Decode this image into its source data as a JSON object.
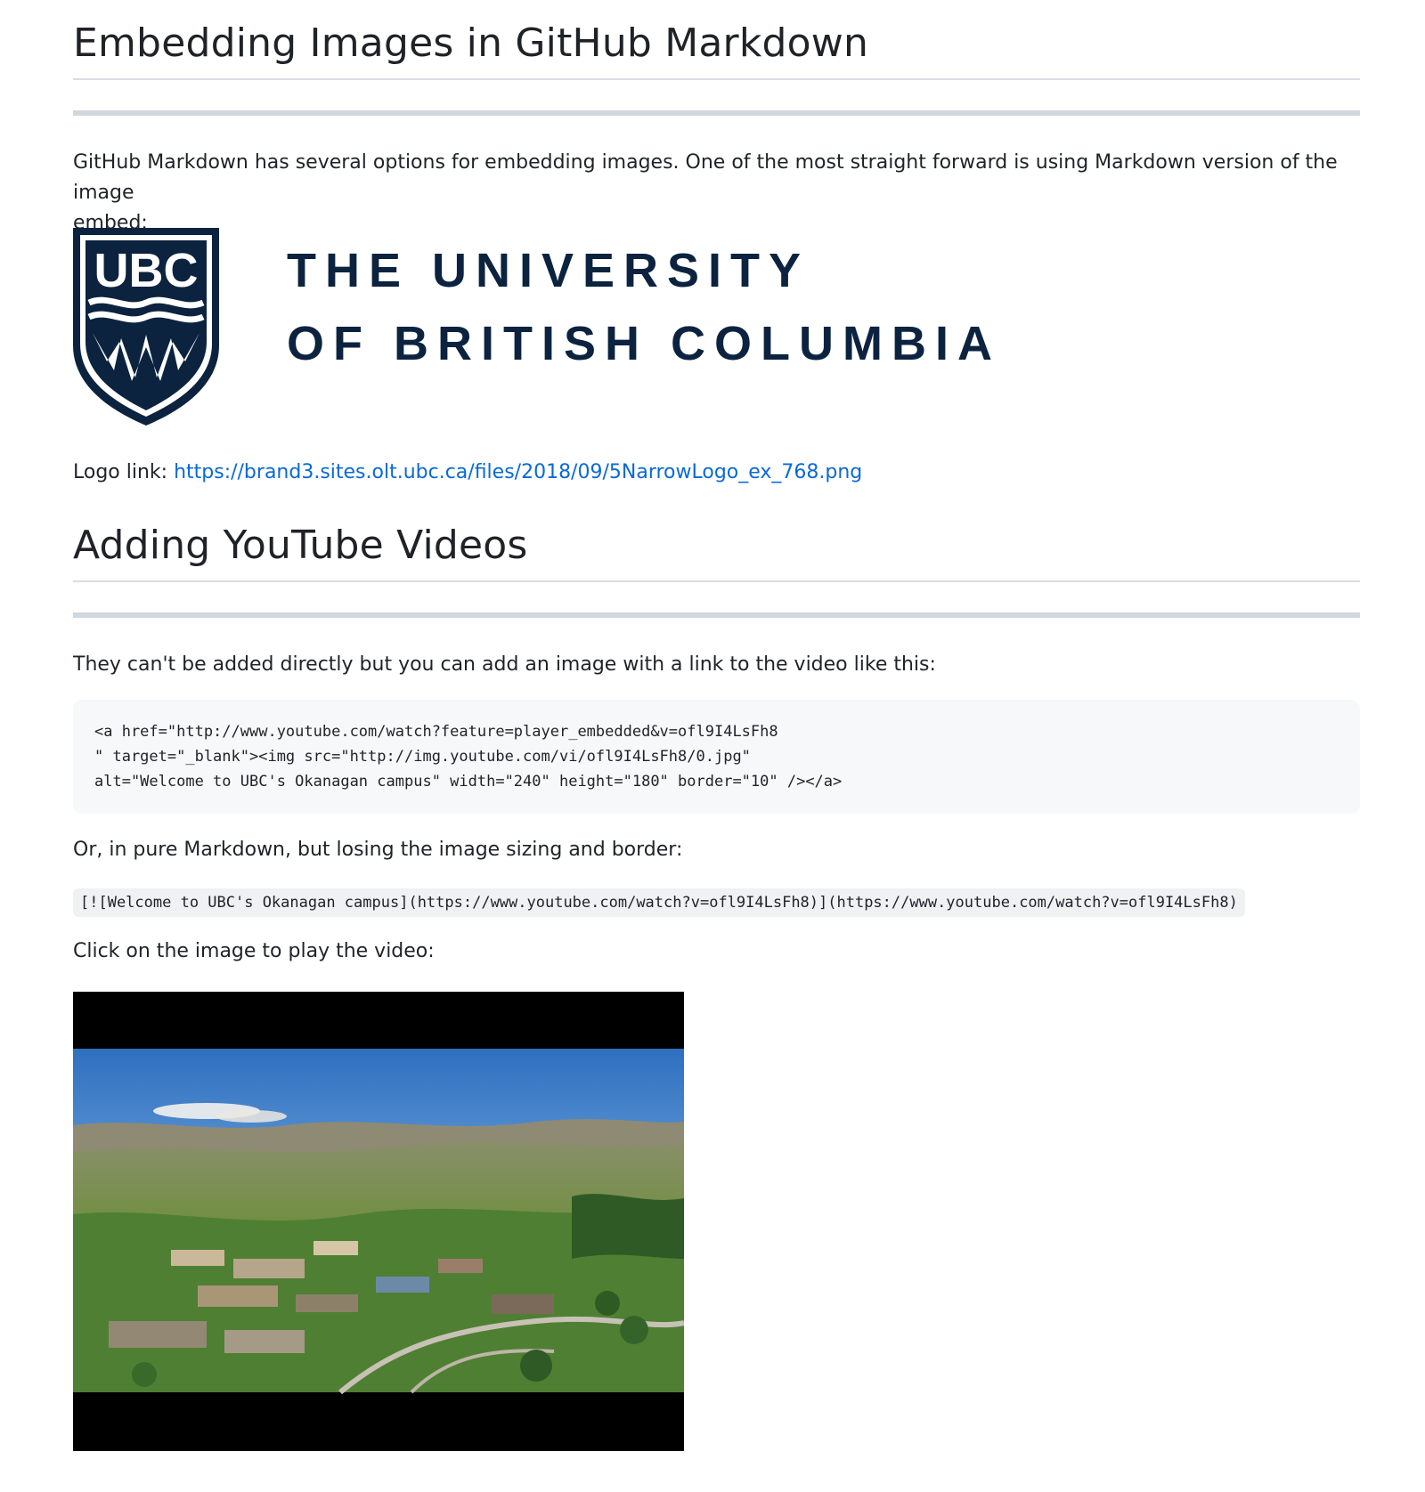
{
  "section1": {
    "heading": "Embedding Images in GitHub Markdown",
    "intro_line1": "GitHub Markdown has several options for embedding images. One of the most straight forward is using Markdown version of the image",
    "intro_line2": "embed:",
    "logo": {
      "shield_text": "UBC",
      "wordmark_line1": "THE UNIVERSITY",
      "wordmark_line2": "OF BRITISH COLUMBIA",
      "color": "#0c2340"
    },
    "logo_link_label": "Logo link:",
    "logo_link_url": "https://brand3.sites.olt.ubc.ca/files/2018/09/5NarrowLogo_ex_768.png"
  },
  "section2": {
    "heading": "Adding YouTube Videos",
    "intro": "They can't be added directly but you can add an image with a link to the video like this:",
    "code_lines": [
      "<a href=\"http://www.youtube.com/watch?feature=player_embedded&v=ofl9I4LsFh8",
      "\" target=\"_blank\"><img src=\"http://img.youtube.com/vi/ofl9I4LsFh8/0.jpg\"",
      "alt=\"Welcome to UBC's Okanagan campus\" width=\"240\" height=\"180\" border=\"10\" /></a>"
    ],
    "markdown_intro": "Or, in pure Markdown, but losing the image sizing and border:",
    "markdown_code": "[![Welcome to UBC's Okanagan campus](https://www.youtube.com/watch?v=ofl9I4LsFh8)](https://www.youtube.com/watch?v=ofl9I4LsFh8)",
    "click_intro": "Click on the image to play the video:"
  },
  "colors": {
    "link": "#0969da",
    "text": "#1f2328",
    "code_bg": "#f6f8fa",
    "ubc_navy": "#0c2340"
  }
}
